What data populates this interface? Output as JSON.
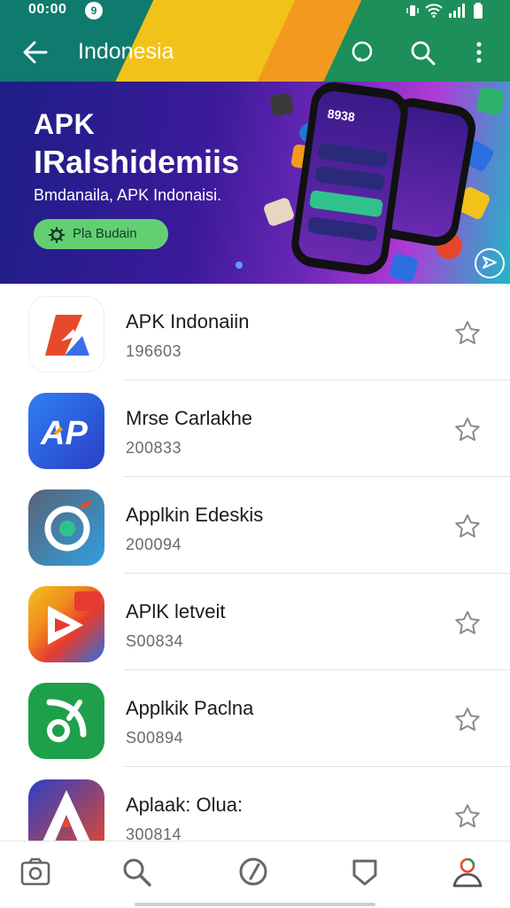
{
  "status_bar": {
    "time": "00:00",
    "notification_glyph": "9"
  },
  "app_bar": {
    "title": "Indonesia"
  },
  "banner": {
    "headline_1": "APK",
    "headline_2": "IRalshidemiis",
    "subtitle": "Bmdanaila, APK Indonaisi.",
    "cta_label": "Pla Budain",
    "phone_text": "8938"
  },
  "apps": [
    {
      "name": "APK Indonaiin",
      "meta": "196603",
      "icon": "apk-icon"
    },
    {
      "name": "Mrse Carlakhe",
      "meta": "200833",
      "icon": "ap-icon"
    },
    {
      "name": "Applkin Edeskis",
      "meta": "200094",
      "icon": "circle-arrow-icon"
    },
    {
      "name": "APlK letveit",
      "meta": "S00834",
      "icon": "red-play-icon"
    },
    {
      "name": "Applkik Paclna",
      "meta": "S00894",
      "icon": "green-leaf-icon"
    },
    {
      "name": "Aplaak: Olua:",
      "meta": "300814",
      "icon": "a-shield-icon"
    }
  ],
  "colors": {
    "header_teal": "#0f7a6e",
    "accent_yellow": "#f2c21a",
    "accent_green": "#63cf72"
  },
  "bottom_nav": [
    "camera-icon",
    "search-icon",
    "compass-icon",
    "shield-icon",
    "profile-icon"
  ]
}
